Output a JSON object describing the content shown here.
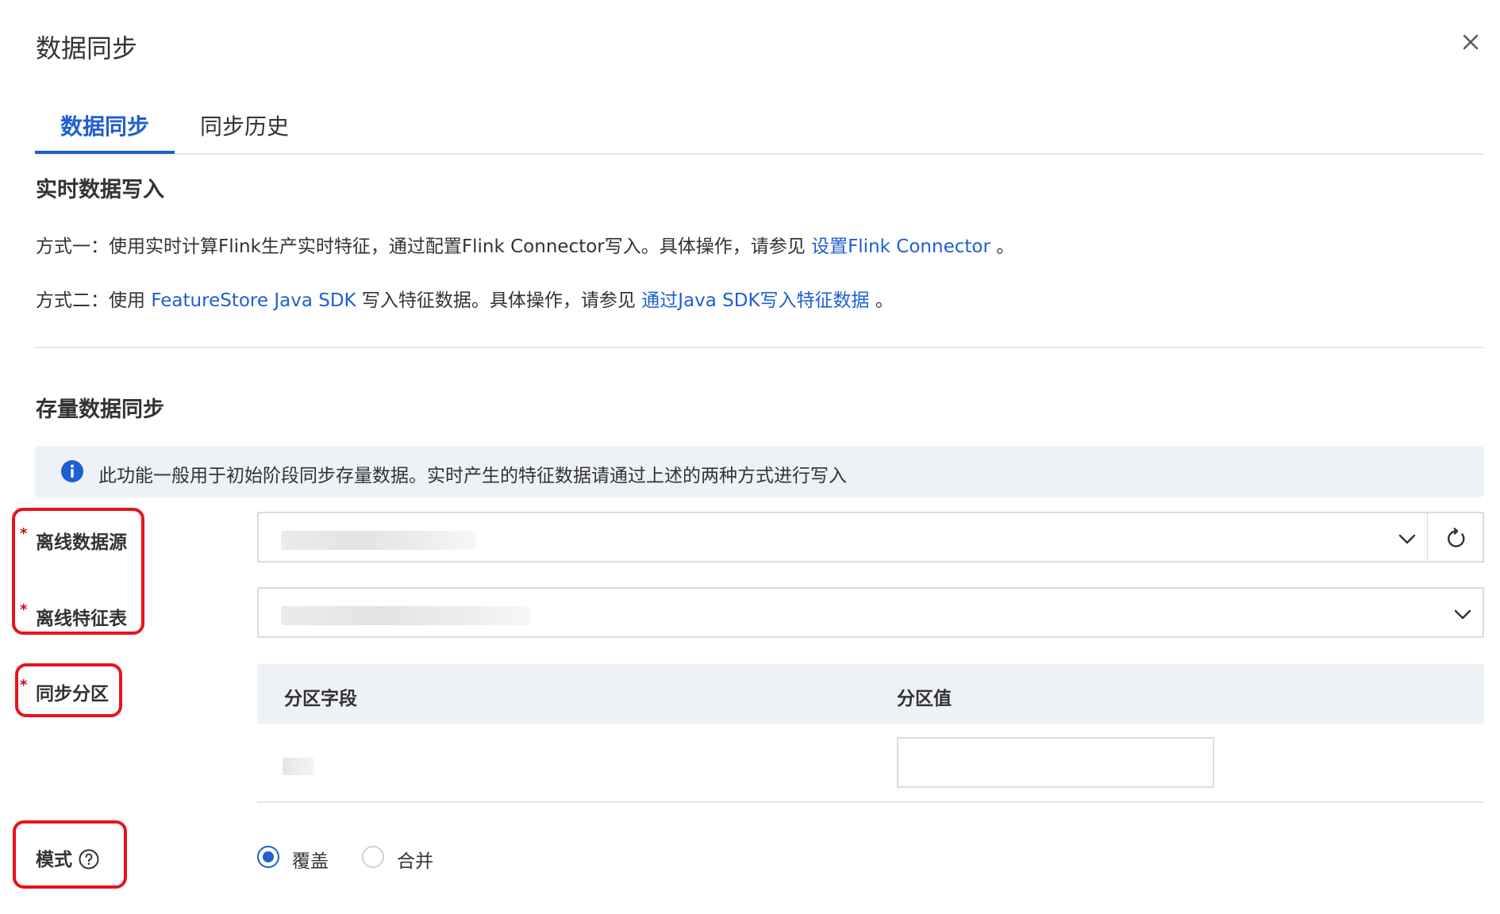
{
  "dialog": {
    "title": "数据同步"
  },
  "tabs": [
    {
      "label": "数据同步",
      "active": true
    },
    {
      "label": "同步历史",
      "active": false
    }
  ],
  "realtime": {
    "title": "实时数据写入",
    "method1": {
      "prefix": "方式一：使用实时计算Flink生产实时特征，通过配置Flink Connector写入。具体操作，请参见 ",
      "link": "设置Flink Connector",
      "suffix": " 。"
    },
    "method2": {
      "prefix": "方式二：使用 ",
      "link1": "FeatureStore Java SDK",
      "middle": " 写入特征数据。具体操作，请参见 ",
      "link2": "通过Java SDK写入特征数据",
      "suffix": " 。"
    }
  },
  "stock": {
    "title": "存量数据同步",
    "info": "此功能一般用于初始阶段同步存量数据。实时产生的特征数据请通过上述的两种方式进行写入"
  },
  "form": {
    "offline_source_label": "离线数据源",
    "offline_table_label": "离线特征表",
    "sync_partition_label": "同步分区",
    "mode_label": "模式",
    "required_mark": "*"
  },
  "partition_table": {
    "columns": [
      "分区字段",
      "分区值"
    ]
  },
  "mode_options": [
    {
      "label": "覆盖",
      "checked": true
    },
    {
      "label": "合并",
      "checked": false
    }
  ],
  "colors": {
    "accent": "#1f5fd1",
    "highlight": "#e8131c",
    "info_bg": "#eef1f6"
  },
  "icons": {
    "close": "close-icon",
    "info": "info-icon",
    "chevron": "chevron-down-icon",
    "refresh": "refresh-icon",
    "help": "help-circle-icon"
  }
}
